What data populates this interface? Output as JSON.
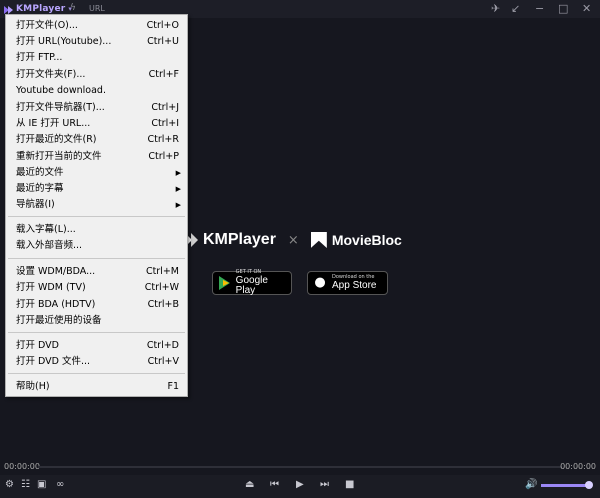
{
  "titlebar": {
    "app_name": "KMPlayer",
    "url_label": "URL",
    "icons": [
      "chevron-down-icon",
      "flash-icon",
      "pin-icon",
      "shrink-icon",
      "minimize-icon",
      "maximize-icon",
      "close-icon"
    ]
  },
  "branding": {
    "kmplayer": "KMPlayer",
    "separator": "×",
    "moviebloc": "MovieBloc",
    "google_play": {
      "small": "GET IT ON",
      "big": "Google Play"
    },
    "app_store": {
      "small": "Download on the",
      "big": "App Store"
    }
  },
  "menu": {
    "items": [
      {
        "label": "打开文件(O)...",
        "shortcut": "Ctrl+O"
      },
      {
        "label": "打开 URL(Youtube)...",
        "shortcut": "Ctrl+U"
      },
      {
        "label": "打开 FTP...",
        "shortcut": ""
      },
      {
        "label": "打开文件夹(F)...",
        "shortcut": "Ctrl+F"
      },
      {
        "label": "Youtube download.",
        "shortcut": ""
      },
      {
        "label": "打开文件导航器(T)...",
        "shortcut": "Ctrl+J"
      },
      {
        "label": "从 IE 打开 URL...",
        "shortcut": "Ctrl+I"
      },
      {
        "label": "打开最近的文件(R)",
        "shortcut": "Ctrl+R"
      },
      {
        "label": "重新打开当前的文件",
        "shortcut": "Ctrl+P"
      },
      {
        "label": "最近的文件",
        "shortcut": ""
      },
      {
        "label": "最近的字幕",
        "shortcut": ""
      },
      {
        "label": "导航器(I)",
        "shortcut": ""
      },
      {
        "label": "载入字幕(L)...",
        "shortcut": ""
      },
      {
        "label": "载入外部音频...",
        "shortcut": ""
      },
      {
        "label": "设置 WDM/BDA...",
        "shortcut": "Ctrl+M"
      },
      {
        "label": "打开 WDM (TV)",
        "shortcut": "Ctrl+W"
      },
      {
        "label": "打开 BDA (HDTV)",
        "shortcut": "Ctrl+B"
      },
      {
        "label": "打开最近使用的设备",
        "shortcut": ""
      },
      {
        "label": "打开 DVD",
        "shortcut": "Ctrl+D"
      },
      {
        "label": "打开 DVD 文件...",
        "shortcut": "Ctrl+V"
      },
      {
        "label": "帮助(H)",
        "shortcut": "F1"
      }
    ],
    "submenu_arrow": "▶"
  },
  "player": {
    "time_elapsed": "00:00:00",
    "time_total": "00:00:00",
    "volume_level": 0.95,
    "control_icons": [
      "settings-icon",
      "equalizer-icon",
      "vr-icon",
      "3d-glasses-icon",
      "eject-icon",
      "previous-icon",
      "play-icon",
      "next-icon",
      "stop-icon",
      "volume-icon"
    ]
  }
}
